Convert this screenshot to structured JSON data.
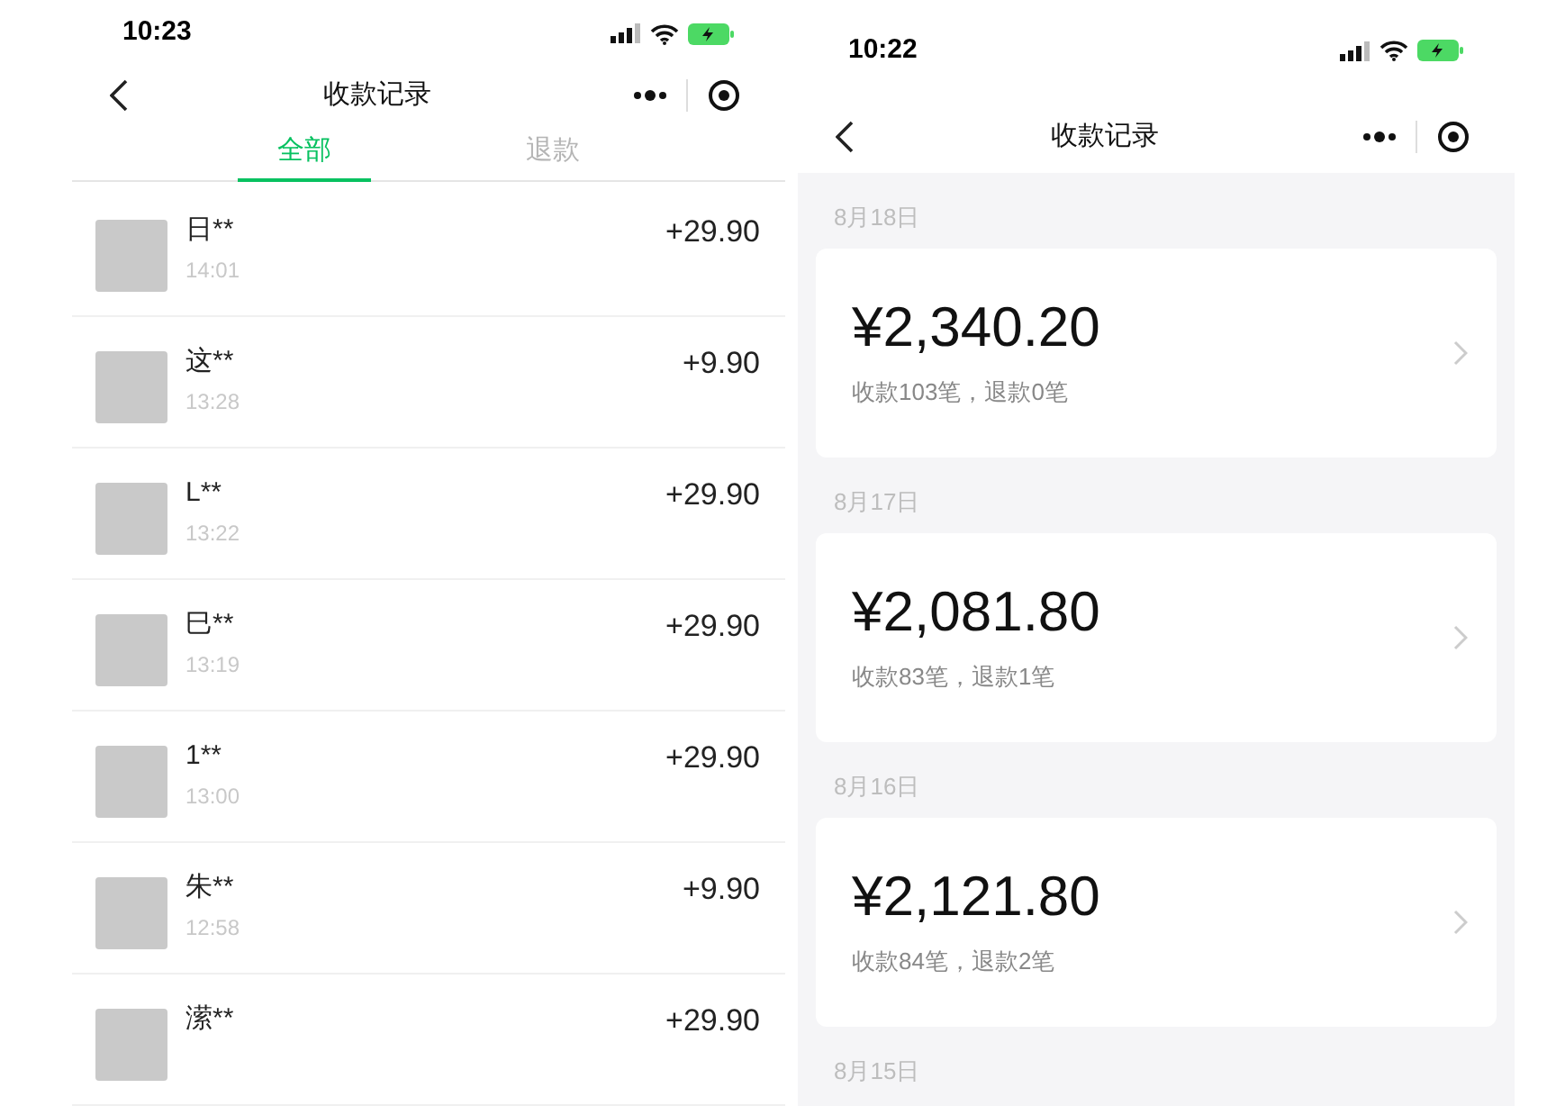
{
  "left_screen": {
    "status_bar": {
      "time": "10:23"
    },
    "nav": {
      "title": "收款记录"
    },
    "tabs": [
      {
        "label": "全部",
        "selected": true
      },
      {
        "label": "退款",
        "selected": false
      }
    ],
    "records": [
      {
        "name": "日**",
        "time": "14:01",
        "amount": "+29.90"
      },
      {
        "name": "这**",
        "time": "13:28",
        "amount": "+9.90"
      },
      {
        "name": "L**",
        "time": "13:22",
        "amount": "+29.90"
      },
      {
        "name": "巳**",
        "time": "13:19",
        "amount": "+29.90"
      },
      {
        "name": "1**",
        "time": "13:00",
        "amount": "+29.90"
      },
      {
        "name": "朱**",
        "time": "12:58",
        "amount": "+9.90"
      },
      {
        "name": "潆**",
        "amount": "+29.90"
      }
    ]
  },
  "right_screen": {
    "status_bar": {
      "time": "10:22"
    },
    "nav": {
      "title": "收款记录"
    },
    "days": [
      {
        "date": "8月18日",
        "total": "¥2,340.20",
        "summary": "收款103笔，退款0笔"
      },
      {
        "date": "8月17日",
        "total": "¥2,081.80",
        "summary": "收款83笔，退款1笔"
      },
      {
        "date": "8月16日",
        "total": "¥2,121.80",
        "summary": "收款84笔，退款2笔"
      },
      {
        "date": "8月15日"
      }
    ]
  }
}
